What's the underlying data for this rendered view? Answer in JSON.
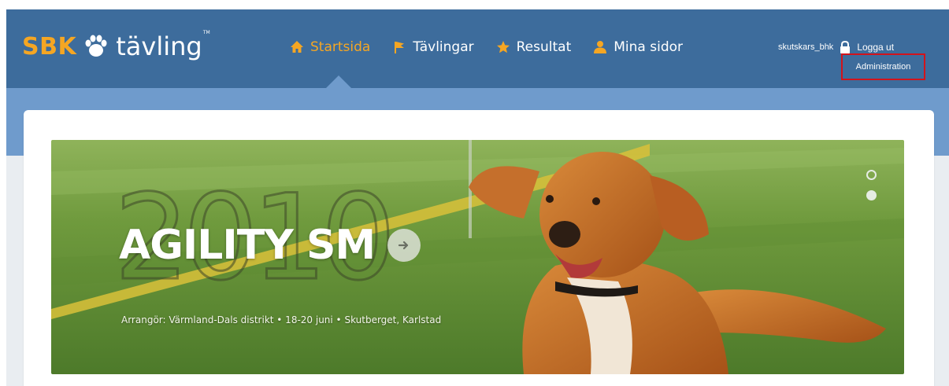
{
  "brand": {
    "logo_sbk": "SBK",
    "logo_tavling": "tävling",
    "logo_tm": "TM",
    "accent_color": "#f5a623",
    "header_color": "#3d6c9c"
  },
  "nav": {
    "items": [
      {
        "label": "Startsida",
        "icon": "home-icon",
        "active": true
      },
      {
        "label": "Tävlingar",
        "icon": "flag-icon",
        "active": false
      },
      {
        "label": "Resultat",
        "icon": "star-icon",
        "active": false
      },
      {
        "label": "Mina sidor",
        "icon": "user-icon",
        "active": false
      }
    ]
  },
  "user": {
    "username": "skutskars_bhk",
    "logout_label": "Logga ut",
    "admin_label": "Administration",
    "highlight_color": "#d3131b"
  },
  "hero": {
    "year": "2010",
    "title": "AGILITY SM",
    "subtitle": "Arrangör: Värmland-Dals distrikt  •  18-20 juni  •  Skutberget, Karlstad",
    "slides_total": 2,
    "active_slide": 2
  }
}
